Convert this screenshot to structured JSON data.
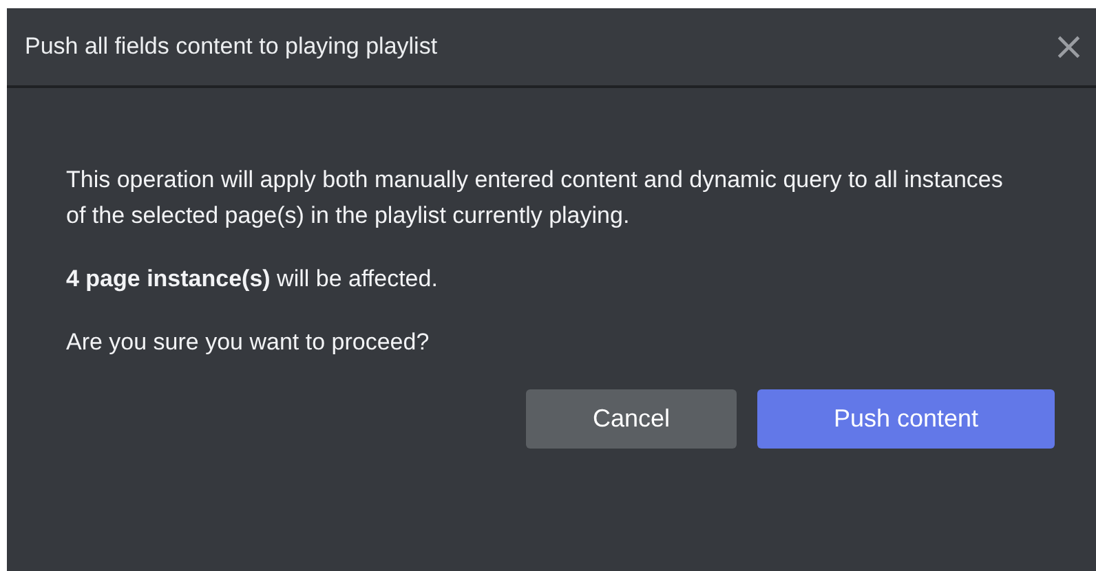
{
  "dialog": {
    "title": "Push all fields content to playing playlist",
    "close": "×",
    "message": "This operation will apply both manually entered content and dynamic query to all instances of the selected page(s) in the playlist currently playing.",
    "affected": "**4 page instance(s)** will be affected.",
    "question": "Are you sure you want to proceed?",
    "buttons": [
      {
        "label": "Cancel",
        "kind": "secondary"
      },
      {
        "label": "Push content",
        "kind": "primary"
      }
    ]
  }
}
